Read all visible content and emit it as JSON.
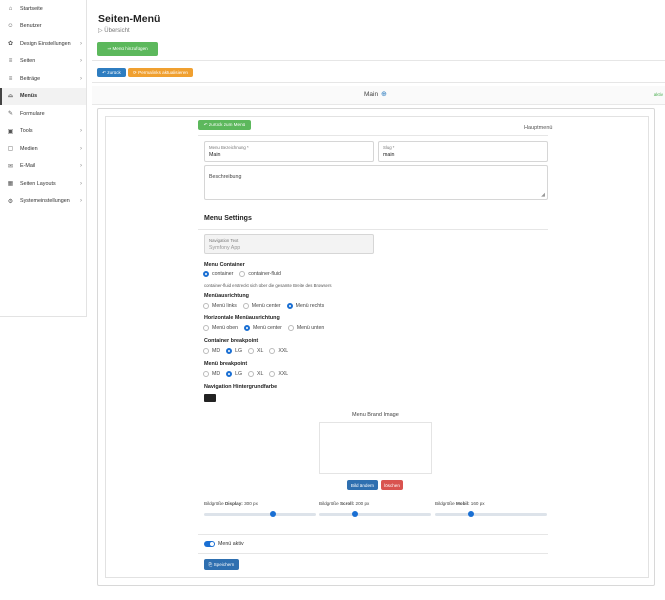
{
  "sidebar": {
    "items": [
      {
        "label": "Startseite",
        "icon": "home-icon",
        "glyph": "⌂",
        "chevron": false
      },
      {
        "label": "Benutzer",
        "icon": "user-icon",
        "glyph": "☺",
        "chevron": false
      },
      {
        "label": "Design Einstellungen",
        "icon": "palette-icon",
        "glyph": "✿",
        "chevron": true
      },
      {
        "label": "Seiten",
        "icon": "list-icon",
        "glyph": "≡",
        "chevron": true
      },
      {
        "label": "Beiträge",
        "icon": "posts-icon",
        "glyph": "≡",
        "chevron": true
      },
      {
        "label": "Menüs",
        "icon": "menu-icon",
        "glyph": "⌓",
        "chevron": false
      },
      {
        "label": "Formulare",
        "icon": "form-icon",
        "glyph": "✎",
        "chevron": false
      },
      {
        "label": "Tools",
        "icon": "tools-icon",
        "glyph": "▣",
        "chevron": true
      },
      {
        "label": "Medien",
        "icon": "media-icon",
        "glyph": "▢",
        "chevron": true
      },
      {
        "label": "E-Mail",
        "icon": "mail-icon",
        "glyph": "✉",
        "chevron": true
      },
      {
        "label": "Seiten Layouts",
        "icon": "layout-icon",
        "glyph": "▦",
        "chevron": true
      },
      {
        "label": "Systemeinstellungen",
        "icon": "gear-icon",
        "glyph": "⚙",
        "chevron": true
      }
    ]
  },
  "header": {
    "title": "Seiten-Menü",
    "breadcrumb": "▷ Übersicht",
    "new_menu_label": "⇒ Menü hinzufügen",
    "back_label": "↶ zurück",
    "permalinks_label": "⟳ Permalinks aktualisieren"
  },
  "menu": {
    "name": "Main",
    "status": "aktiv",
    "back_to_menu_label": "↶ zurück zum Menü",
    "type_label": "Hauptmenü"
  },
  "form": {
    "name_label": "Menu Bezeichnung *",
    "name_value": "Main",
    "slug_label": "Slug *",
    "slug_value": "main",
    "description_label": "Beschreibung",
    "settings_title": "Menu Settings",
    "nav_text_label": "Navigation Text",
    "nav_text_value": "Symfony App",
    "container_title": "Menu Container",
    "container_options": [
      "container",
      "container-fluid"
    ],
    "container_note": "container-fluid erstreckt sich über die gesamte Breite des Browsers",
    "alignment_title": "Menüausrichtung",
    "alignment_options": [
      "Menü links",
      "Menü center",
      "Menü rechts"
    ],
    "horizontal_title": "Horizontale Menüausrichtung",
    "horizontal_options": [
      "Menü oben",
      "Menü center",
      "Menü unten"
    ],
    "container_bp_title": "Container breakpoint",
    "menu_bp_title": "Menü breakpoint",
    "breakpoints": [
      "MD",
      "LG",
      "XL",
      "XXL"
    ],
    "bg_title": "Navigation Hintergrundfarbe",
    "bg_color": "#222222",
    "brand_title": "Menu Brand Image",
    "change_image_label": "Bild ändern",
    "delete_label": "löschen",
    "size_display_prefix": "Bildgröße",
    "size_display_name": "Display:",
    "size_display_value": "300 px",
    "size_scroll_name": "Scroll:",
    "size_scroll_value": "200 px",
    "size_mobile_name": "Mobil:",
    "size_mobile_value": "160 px",
    "slider_display": 0.62,
    "slider_scroll": 0.32,
    "slider_mobile": 0.32,
    "active_label": "Menü aktiv",
    "save_label": "⎘ Speichern"
  },
  "colors": {
    "primary": "#1a6fd3",
    "green": "#5cb85c",
    "orange": "#f0a030",
    "red": "#d9534f"
  }
}
